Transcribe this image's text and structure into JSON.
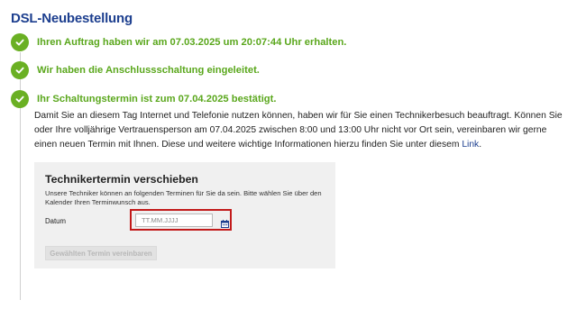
{
  "page": {
    "title": "DSL-Neubestellung"
  },
  "steps": [
    {
      "text": "Ihren Auftrag haben wir am 07.03.2025 um 20:07:44 Uhr erhalten.",
      "icon": "check-circle-icon"
    },
    {
      "text": "Wir haben die Anschlussschaltung eingeleitet.",
      "icon": "check-circle-icon"
    },
    {
      "text": "Ihr Schaltungstermin ist zum 07.04.2025 bestätigt.",
      "icon": "check-circle-icon"
    }
  ],
  "description": {
    "text": "Damit Sie an diesem Tag Internet und Telefonie nutzen können, haben wir für Sie einen Technikerbesuch beauftragt. Können Sie oder Ihre volljährige Vertrauensperson am 07.04.2025 zwischen 8:00 und 13:00 Uhr nicht vor Ort sein, vereinbaren wir gerne einen neuen Termin mit Ihnen. Diese und weitere wichtige Informationen hierzu finden Sie unter diesem ",
    "link_label": "Link",
    "end": "."
  },
  "reschedule": {
    "title": "Technikertermin verschieben",
    "text": "Unsere Techniker können an folgenden Terminen für Sie da sein. Bitte wählen Sie über den Kalender Ihren Terminwunsch aus.",
    "date_label": "Datum",
    "date_placeholder": "TT.MM.JJJJ",
    "date_value": "",
    "calendar_icon": "calendar-icon",
    "submit_label": "Gewählten Termin vereinbaren"
  },
  "colors": {
    "accent_blue": "#1d3f8f",
    "success_green": "#5aa71c",
    "check_green": "#6ab023",
    "highlight_red": "#c21a1a",
    "panel_bg": "#f0f0f0"
  }
}
